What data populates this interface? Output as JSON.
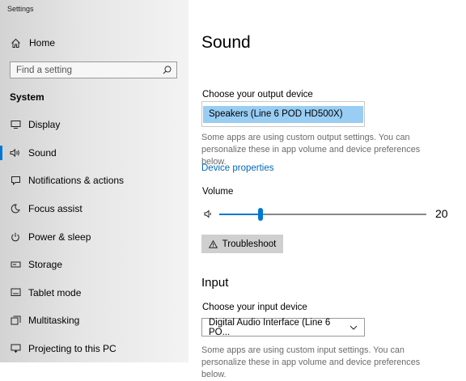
{
  "window": {
    "title": "Settings"
  },
  "sidebar": {
    "home_label": "Home",
    "search_placeholder": "Find a setting",
    "section_title": "System",
    "items": [
      {
        "label": "Display",
        "icon": "display-icon",
        "active": false
      },
      {
        "label": "Sound",
        "icon": "speaker-icon",
        "active": true
      },
      {
        "label": "Notifications & actions",
        "icon": "notifications-icon",
        "active": false
      },
      {
        "label": "Focus assist",
        "icon": "moon-icon",
        "active": false
      },
      {
        "label": "Power & sleep",
        "icon": "power-icon",
        "active": false
      },
      {
        "label": "Storage",
        "icon": "storage-icon",
        "active": false
      },
      {
        "label": "Tablet mode",
        "icon": "tablet-icon",
        "active": false
      },
      {
        "label": "Multitasking",
        "icon": "multitasking-icon",
        "active": false
      },
      {
        "label": "Projecting to this PC",
        "icon": "projecting-icon",
        "active": false
      }
    ]
  },
  "main": {
    "title": "Sound",
    "output": {
      "label": "Choose your output device",
      "selected": "Speakers (Line 6 POD HD500X)",
      "description": "Some apps are using custom output settings. You can personalize these in app volume and device preferences below.",
      "device_properties_link": "Device properties",
      "volume_label": "Volume",
      "volume_value": "20",
      "volume_fraction": 0.2,
      "troubleshoot_label": "Troubleshoot"
    },
    "input": {
      "heading": "Input",
      "label": "Choose your input device",
      "selected": "Digital Audio Interface (Line 6 PO...",
      "description": "Some apps are using custom input settings. You can personalize these in app volume and device preferences below."
    }
  },
  "colors": {
    "accent": "#0078d4",
    "link": "#0067b8",
    "selection": "#99cdf3"
  }
}
